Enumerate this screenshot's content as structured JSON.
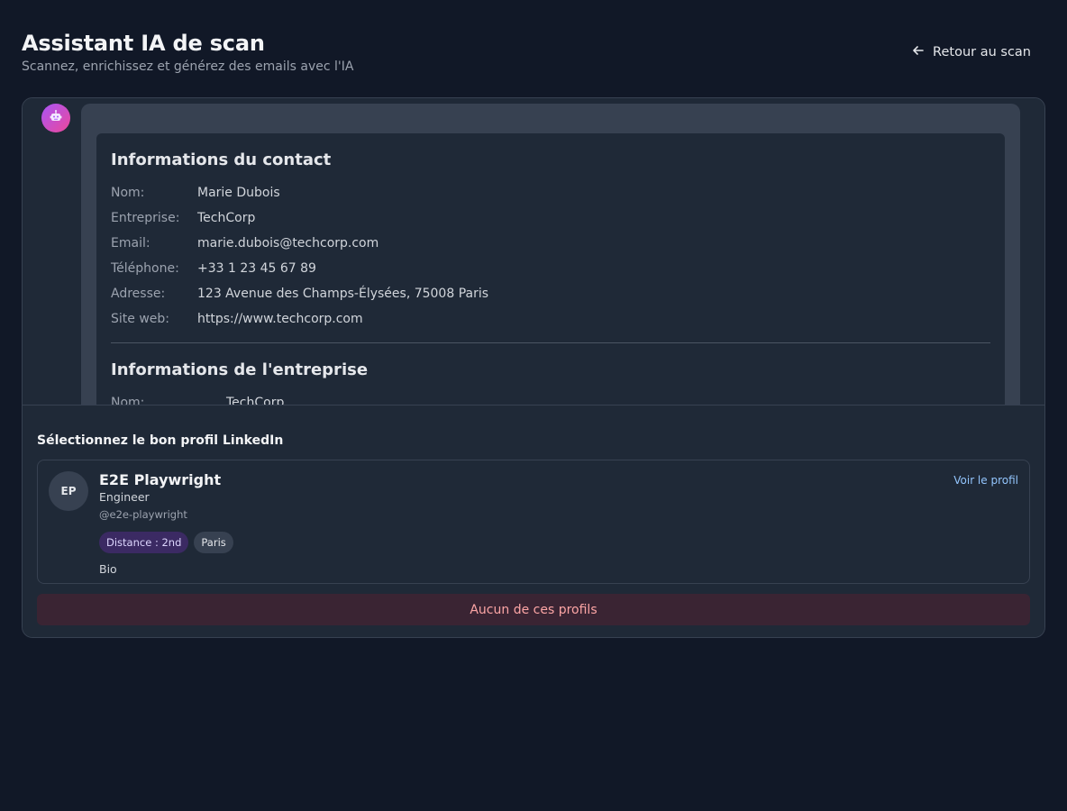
{
  "header": {
    "title": "Assistant IA de scan",
    "subtitle": "Scannez, enrichissez et générez des emails avec l'IA",
    "back_label": "Retour au scan",
    "back_icon": "arrow-left-icon"
  },
  "chat": {
    "bot_icon": "robot-icon",
    "contact": {
      "title": "Informations du contact",
      "rows": [
        {
          "label": "Nom:",
          "value": "Marie Dubois"
        },
        {
          "label": "Entreprise:",
          "value": "TechCorp"
        },
        {
          "label": "Email:",
          "value": "marie.dubois@techcorp.com"
        },
        {
          "label": "Téléphone:",
          "value": "+33 1 23 45 67 89"
        },
        {
          "label": "Adresse:",
          "value": "123 Avenue des Champs-Élysées, 75008 Paris"
        },
        {
          "label": "Site web:",
          "value": "https://www.techcorp.com"
        }
      ]
    },
    "company": {
      "title": "Informations de l'entreprise",
      "rows": [
        {
          "label": "Nom:",
          "value": "TechCorp"
        }
      ]
    }
  },
  "linkedin": {
    "title": "Sélectionnez le bon profil LinkedIn",
    "profile": {
      "initials": "EP",
      "name": "E2E Playwright",
      "role": "Engineer",
      "handle": "@e2e-playwright",
      "distance": "Distance : 2nd",
      "location": "Paris",
      "bio": "Bio",
      "view_label": "Voir le profil"
    },
    "none_label": "Aucun de ces profils"
  },
  "colors": {
    "background": "#111827",
    "panel": "#1f2937",
    "accent_link": "#93c5fd",
    "danger_text": "#fca5a5",
    "avatar_gradient_start": "#a855f7",
    "avatar_gradient_end": "#ec4899"
  }
}
